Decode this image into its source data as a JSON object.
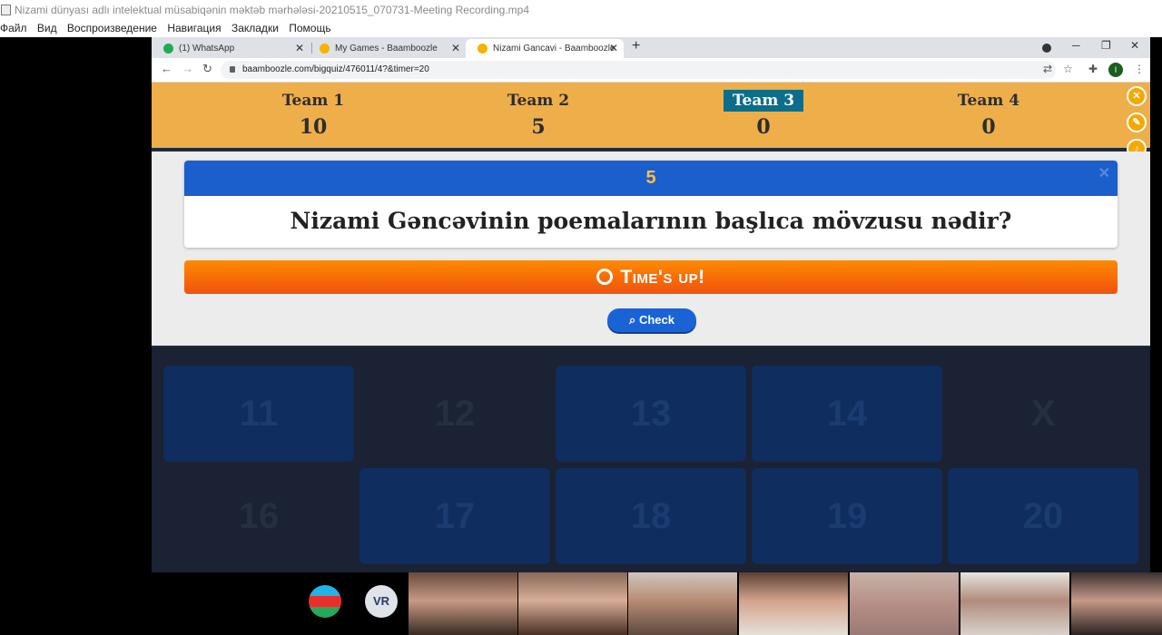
{
  "player": {
    "title": "Nizami dünyası adlı intelektual müsabiqənin məktəb mərhələsi-20210515_070731-Meeting Recording.mp4",
    "menu": [
      "Файл",
      "Вид",
      "Воспроизведение",
      "Навигация",
      "Закладки",
      "Помощь"
    ]
  },
  "browser": {
    "tabs": [
      {
        "label": "(1) WhatsApp",
        "icon": "whatsapp-icon",
        "badge": "1"
      },
      {
        "label": "My Games - Baamboozle",
        "icon": "baamboozle-icon"
      },
      {
        "label": "Nizami Gancavi - Baamboozle",
        "icon": "baamboozle-icon"
      }
    ],
    "new_tab": "+",
    "url": "baamboozle.com/bigquiz/476011/4?&timer=20",
    "profile_initial": "I"
  },
  "teams": [
    {
      "name": "Team 1",
      "score": "10"
    },
    {
      "name": "Team 2",
      "score": "5"
    },
    {
      "name": "Team 3",
      "score": "0"
    },
    {
      "name": "Team 4",
      "score": "0"
    }
  ],
  "question": {
    "points": "5",
    "text": "Nizami Gəncəvinin poemalarının başlıca mövzusu nədir?",
    "status": "Time's up!",
    "check_label": "Check"
  },
  "board": {
    "tiles": [
      "11",
      "12",
      "13",
      "14",
      "X",
      "16",
      "17",
      "18",
      "19",
      "20"
    ]
  },
  "participants": {
    "initials": "VR"
  },
  "colors": {
    "team_bar": "#eeae4a",
    "current_team": "#0c6e8a",
    "question_header": "#1a5fcc",
    "times_up": "#f0520c",
    "check_button": "#1a63d6"
  }
}
